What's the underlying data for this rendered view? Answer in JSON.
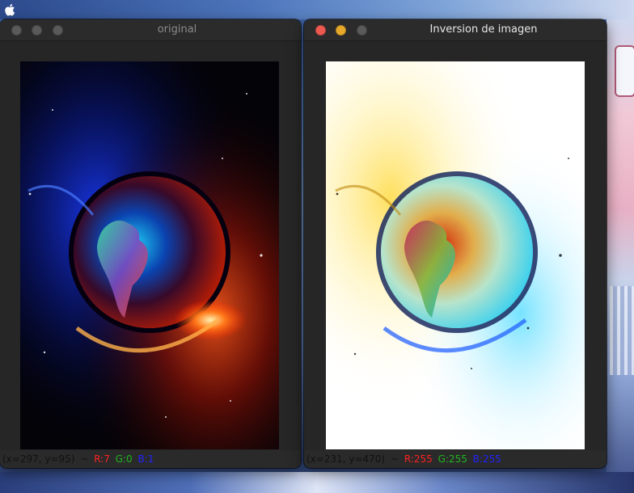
{
  "menubar": {
    "apple_icon": "apple-icon"
  },
  "windows": [
    {
      "title": "original",
      "status": {
        "coords": "(x=297, y=95)",
        "sep": "~",
        "r": "R:7",
        "g": "G:0",
        "b": "B:1"
      },
      "traffic_lights": [
        "#5a5a5a",
        "#5a5a5a",
        "#5a5a5a"
      ]
    },
    {
      "title": "Inversion de imagen",
      "status": {
        "coords": "(x=231, y=470)",
        "sep": "~",
        "r": "R:255",
        "g": "G:255",
        "b": "B:255"
      },
      "traffic_lights": [
        "#ee5a52",
        "#e8a92a",
        "#5a5a5a"
      ]
    }
  ],
  "colors": {
    "window_bg": "#262626",
    "titlebar_bg": "#2b2b2b",
    "status_r": "#ff2020",
    "status_g": "#1fb51f",
    "status_b": "#2222ff"
  }
}
